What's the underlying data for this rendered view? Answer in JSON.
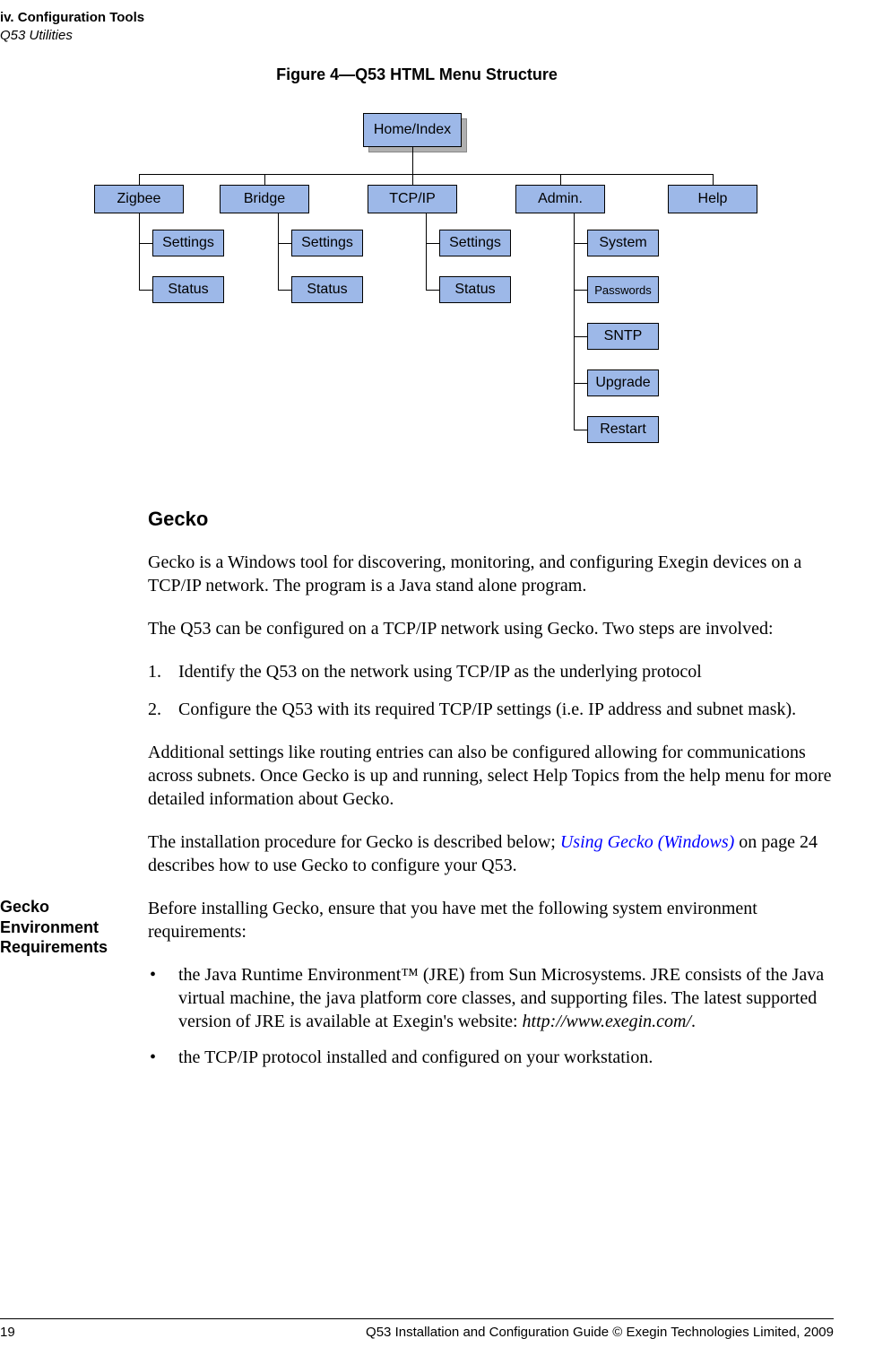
{
  "header": {
    "line1": "iv. Configuration Tools",
    "line2": "Q53 Utilities"
  },
  "figure_caption": "Figure 4—Q53 HTML Menu Structure",
  "diagram": {
    "root": "Home/Index",
    "branches": [
      "Zigbee",
      "Bridge",
      "TCP/IP",
      "Admin.",
      "Help"
    ],
    "zigbee_children": [
      "Settings",
      "Status"
    ],
    "bridge_children": [
      "Settings",
      "Status"
    ],
    "tcpip_children": [
      "Settings",
      "Status"
    ],
    "admin_children": [
      "System",
      "Passwords",
      "SNTP",
      "Upgrade",
      "Restart"
    ]
  },
  "section_heading": "Gecko",
  "para1": "Gecko is a Windows tool for discovering, monitoring, and configuring Exegin devices on a TCP/IP network. The program is a Java stand alone program.",
  "para2_intro": "The Q53 can be configured on a TCP/IP network using Gecko. Two steps are involved:",
  "ol": [
    "Identify the Q53 on the network using TCP/IP as the underlying protocol",
    "Configure the Q53 with its required TCP/IP settings (i.e. IP address and subnet mask)."
  ],
  "para3": "Additional settings like routing entries can also be configured allowing for communications across subnets. Once Gecko is up and running, select Help Topics from the help menu for more detailed information about Gecko.",
  "para4_pre": "The installation procedure for Gecko is described below; ",
  "para4_link": "Using Gecko (Windows)",
  "para4_post": " on page 24 describes how to use Gecko to configure your Q53.",
  "side_label": "Gecko Environment Requirements",
  "req_intro": "Before installing Gecko, ensure that you have met the following system environment requirements:",
  "req_items": [
    {
      "text_pre": "the Java Runtime Environment™ (JRE) from Sun Microsystems. JRE consists of the Java virtual machine, the java platform core classes, and supporting files. The latest supported version of JRE is available at Exegin's website: ",
      "text_italic": "http://www.exegin.com/",
      "text_post": "."
    },
    {
      "text_pre": "the TCP/IP protocol installed and configured on your workstation.",
      "text_italic": "",
      "text_post": ""
    }
  ],
  "footer": {
    "page": "19",
    "text": "Q53 Installation and Configuration Guide  © Exegin Technologies Limited, 2009"
  }
}
